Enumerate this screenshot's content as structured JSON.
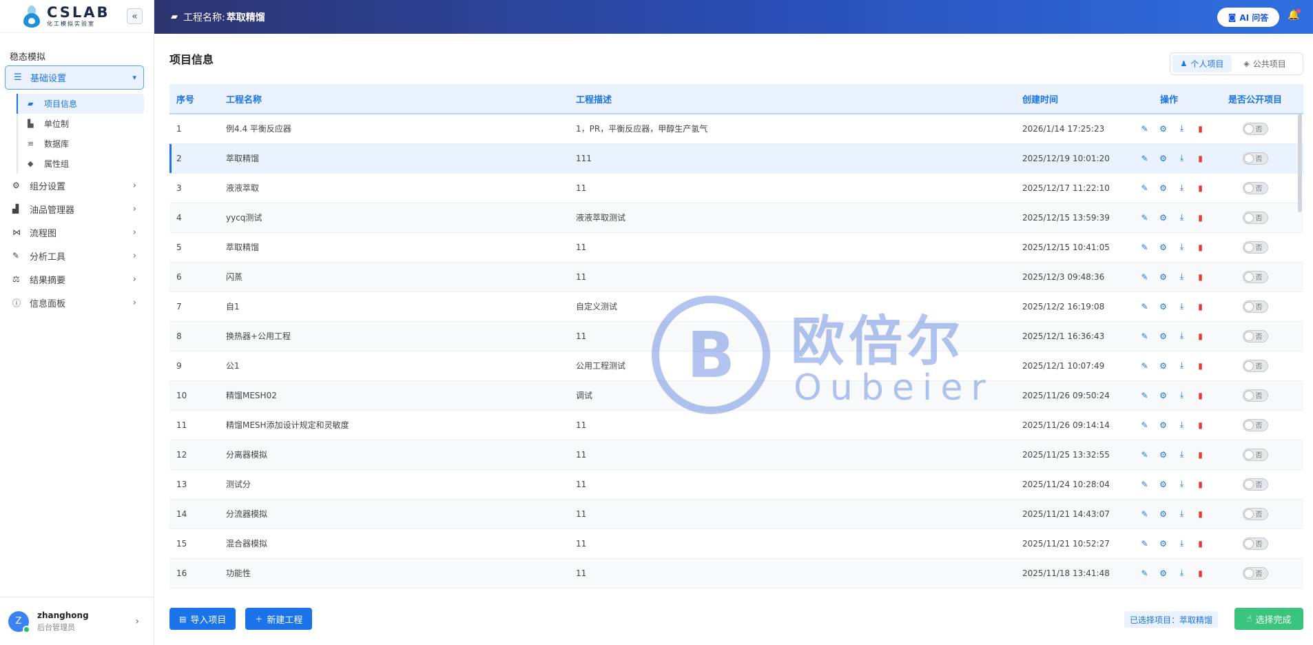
{
  "brand": {
    "title": "CSLAB",
    "subtitle": "化工模拟实验室"
  },
  "sidebar": {
    "collapse_icon": "«",
    "section_title": "稳态模拟",
    "active_group": {
      "label": "基础设置",
      "icon": "sliders-icon"
    },
    "sub_items": [
      {
        "label": "项目信息",
        "icon": "folder-icon",
        "active": true
      },
      {
        "label": "单位制",
        "icon": "ruler-icon",
        "active": false
      },
      {
        "label": "数据库",
        "icon": "database-icon",
        "active": false
      },
      {
        "label": "属性组",
        "icon": "tags-icon",
        "active": false
      }
    ],
    "groups": [
      {
        "label": "组分设置",
        "icon": "cog-icon"
      },
      {
        "label": "油品管理器",
        "icon": "chart-icon"
      },
      {
        "label": "流程图",
        "icon": "flow-icon"
      },
      {
        "label": "分析工具",
        "icon": "wrench-icon"
      },
      {
        "label": "结果摘要",
        "icon": "scale-icon"
      },
      {
        "label": "信息面板",
        "icon": "info-icon"
      }
    ]
  },
  "user": {
    "initial": "Z",
    "name": "zhanghong",
    "role": "后台管理员"
  },
  "header": {
    "label": "工程名称:",
    "value": "萃取精馏",
    "ai_label": "AI 问答"
  },
  "main": {
    "title": "项目信息",
    "toggle": {
      "personal": "个人项目",
      "public": "公共项目"
    },
    "columns": {
      "index": "序号",
      "name": "工程名称",
      "desc": "工程描述",
      "created": "创建时间",
      "ops": "操作",
      "public": "是否公开项目"
    },
    "rows": [
      {
        "index": "1",
        "name": "例4.4 平衡反应器",
        "desc": "1，PR，平衡反应器，甲醇生产氢气",
        "created": "2026/1/14 17:25:23",
        "public": "否"
      },
      {
        "index": "2",
        "name": "萃取精馏",
        "desc": "111",
        "created": "2025/12/19 10:01:20",
        "public": "否"
      },
      {
        "index": "3",
        "name": "液液萃取",
        "desc": "11",
        "created": "2025/12/17 11:22:10",
        "public": "否"
      },
      {
        "index": "4",
        "name": "yycq测试",
        "desc": "液液萃取测试",
        "created": "2025/12/15 13:59:39",
        "public": "否"
      },
      {
        "index": "5",
        "name": "萃取精馏",
        "desc": "11",
        "created": "2025/12/15 10:41:05",
        "public": "否"
      },
      {
        "index": "6",
        "name": "闪蒸",
        "desc": "11",
        "created": "2025/12/3 09:48:36",
        "public": "否"
      },
      {
        "index": "7",
        "name": "自1",
        "desc": "自定义测试",
        "created": "2025/12/2 16:19:08",
        "public": "否"
      },
      {
        "index": "8",
        "name": "换热器+公用工程",
        "desc": "11",
        "created": "2025/12/1 16:36:43",
        "public": "否"
      },
      {
        "index": "9",
        "name": "公1",
        "desc": "公用工程测试",
        "created": "2025/12/1 10:07:49",
        "public": "否"
      },
      {
        "index": "10",
        "name": "精馏MESH02",
        "desc": "调试",
        "created": "2025/11/26 09:50:24",
        "public": "否"
      },
      {
        "index": "11",
        "name": "精馏MESH添加设计规定和灵敏度",
        "desc": "11",
        "created": "2025/11/26 09:14:14",
        "public": "否"
      },
      {
        "index": "12",
        "name": "分离器模拟",
        "desc": "11",
        "created": "2025/11/25 13:32:55",
        "public": "否"
      },
      {
        "index": "13",
        "name": "测试分",
        "desc": "11",
        "created": "2025/11/24 10:28:04",
        "public": "否"
      },
      {
        "index": "14",
        "name": "分流器模拟",
        "desc": "11",
        "created": "2025/11/21 14:43:07",
        "public": "否"
      },
      {
        "index": "15",
        "name": "混合器模拟",
        "desc": "11",
        "created": "2025/11/21 10:52:27",
        "public": "否"
      },
      {
        "index": "16",
        "name": "功能性",
        "desc": "11",
        "created": "2025/11/18 13:41:48",
        "public": "否"
      }
    ],
    "selected_row": 2
  },
  "watermark": {
    "cn": "欧倍尔",
    "en": "Oubeier"
  },
  "footer": {
    "import_label": "导入项目",
    "new_label": "新建工程",
    "selected_label": "已选择项目：",
    "selected_value": "萃取精馏",
    "done_label": "选择完成"
  },
  "colors": {
    "primary": "#1a73e8",
    "danger": "#e53935",
    "success": "#3ac47d",
    "header_start": "#2d3470",
    "header_end": "#2f6fe0"
  }
}
